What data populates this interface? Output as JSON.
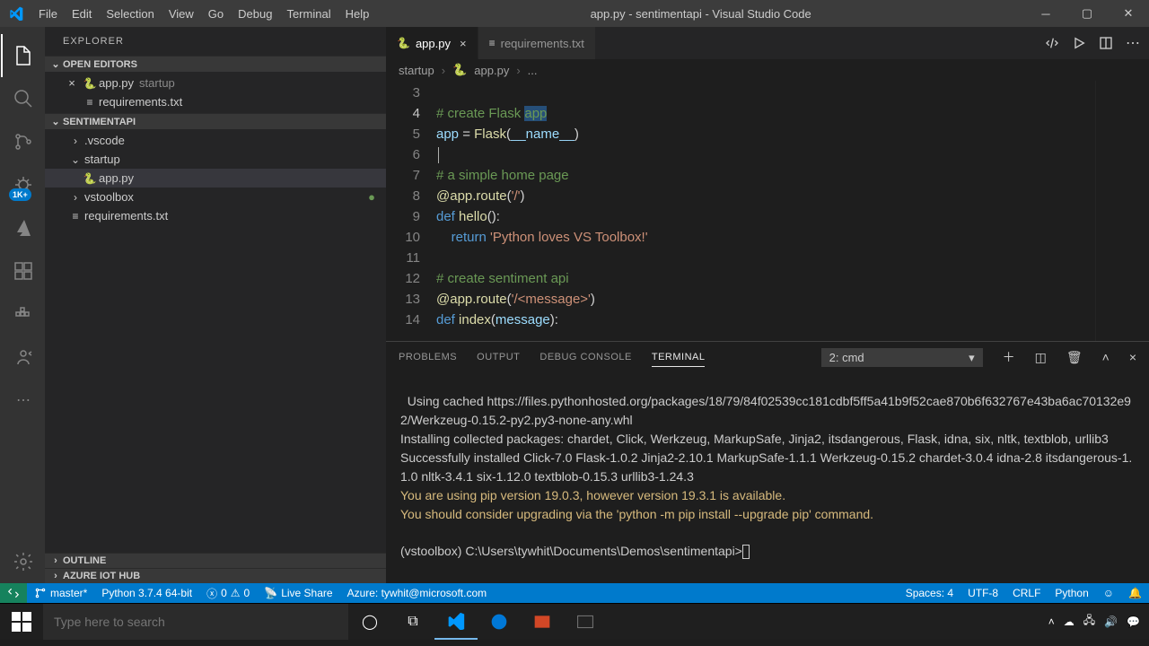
{
  "titlebar": {
    "menu": [
      "File",
      "Edit",
      "Selection",
      "View",
      "Go",
      "Debug",
      "Terminal",
      "Help"
    ],
    "title": "app.py - sentimentapi - Visual Studio Code"
  },
  "activitybar": {
    "badge": "1K+"
  },
  "sidebar": {
    "title": "EXPLORER",
    "openEditors": {
      "label": "OPEN EDITORS",
      "items": [
        {
          "name": "app.py",
          "hint": "startup",
          "icon": "py",
          "closable": true
        },
        {
          "name": "requirements.txt",
          "hint": "",
          "icon": "txt",
          "closable": false
        }
      ]
    },
    "workspace": {
      "label": "SENTIMENTAPI",
      "tree": [
        {
          "name": ".vscode",
          "kind": "folder",
          "depth": 0,
          "expanded": false
        },
        {
          "name": "startup",
          "kind": "folder",
          "depth": 0,
          "expanded": true
        },
        {
          "name": "app.py",
          "kind": "file-py",
          "depth": 1,
          "selected": true
        },
        {
          "name": "vstoolbox",
          "kind": "folder",
          "depth": 0,
          "expanded": false,
          "modified": true
        },
        {
          "name": "requirements.txt",
          "kind": "file-txt",
          "depth": 0
        }
      ]
    },
    "outline": "OUTLINE",
    "azure": "AZURE IOT HUB"
  },
  "tabs": [
    {
      "name": "app.py",
      "icon": "py",
      "active": true
    },
    {
      "name": "requirements.txt",
      "icon": "txt",
      "active": false
    }
  ],
  "breadcrumb": {
    "a": "startup",
    "b": "app.py",
    "c": "..."
  },
  "code": {
    "lines": [
      {
        "n": 3,
        "html": ""
      },
      {
        "n": 4,
        "html": "<span class='tok-comment'># create Flask </span><span class='tok-comment sel-box'>app</span>"
      },
      {
        "n": 5,
        "html": "<span class='tok-var'>app</span><span class='tok-plain'> = </span><span class='tok-fn'>Flask</span><span class='tok-plain'>(</span><span class='tok-var'>__name__</span><span class='tok-plain'>)</span>"
      },
      {
        "n": 6,
        "html": "<span class='cursor'></span>"
      },
      {
        "n": 7,
        "html": "<span class='tok-comment'># a simple home page</span>"
      },
      {
        "n": 8,
        "html": "<span class='tok-dec'>@app.route</span><span class='tok-plain'>(</span><span class='tok-str'>'/'</span><span class='tok-plain'>)</span>"
      },
      {
        "n": 9,
        "html": "<span class='tok-kw'>def</span><span class='tok-plain'> </span><span class='tok-fn'>hello</span><span class='tok-plain'>():</span>"
      },
      {
        "n": 10,
        "html": "    <span class='tok-kw'>return</span><span class='tok-plain'> </span><span class='tok-str'>'Python loves VS Toolbox!'</span>"
      },
      {
        "n": 11,
        "html": ""
      },
      {
        "n": 12,
        "html": "<span class='tok-comment'># create sentiment api</span>"
      },
      {
        "n": 13,
        "html": "<span class='tok-dec'>@app.route</span><span class='tok-plain'>(</span><span class='tok-str'>'/&lt;message&gt;'</span><span class='tok-plain'>)</span>"
      },
      {
        "n": 14,
        "html": "<span class='tok-kw'>def</span><span class='tok-plain'> </span><span class='tok-fn'>index</span><span class='tok-plain'>(</span><span class='tok-var'>message</span><span class='tok-plain'>):</span>"
      }
    ],
    "activeLine": 4
  },
  "panel": {
    "tabs": [
      "PROBLEMS",
      "OUTPUT",
      "DEBUG CONSOLE",
      "TERMINAL"
    ],
    "active": 3,
    "select": "2: cmd",
    "terminal": {
      "plain1": "  Using cached https://files.pythonhosted.org/packages/18/79/84f02539cc181cdbf5ff5a41b9f52cae870b6f632767e43ba6ac70132e92/Werkzeug-0.15.2-py2.py3-none-any.whl",
      "plain2": "Installing collected packages: chardet, Click, Werkzeug, MarkupSafe, Jinja2, itsdangerous, Flask, idna, six, nltk, textblob, urllib3",
      "plain3": "Successfully installed Click-7.0 Flask-1.0.2 Jinja2-2.10.1 MarkupSafe-1.1.1 Werkzeug-0.15.2 chardet-3.0.4 idna-2.8 itsdangerous-1.1.0 nltk-3.4.1 six-1.12.0 textblob-0.15.3 urllib3-1.24.3",
      "warn1": "You are using pip version 19.0.3, however version 19.3.1 is available.",
      "warn2": "You should consider upgrading via the 'python -m pip install --upgrade pip' command.",
      "prompt": "(vstoolbox) C:\\Users\\tywhit\\Documents\\Demos\\sentimentapi>"
    }
  },
  "statusbar": {
    "branch": "master*",
    "python": "Python 3.7.4 64-bit",
    "errors": "0",
    "warnings": "0",
    "liveshare": "Live Share",
    "azure": "Azure: tywhit@microsoft.com",
    "spaces": "Spaces: 4",
    "encoding": "UTF-8",
    "eol": "CRLF",
    "lang": "Python"
  },
  "taskbar": {
    "searchPlaceholder": "Type here to search",
    "time": "",
    "date": ""
  }
}
